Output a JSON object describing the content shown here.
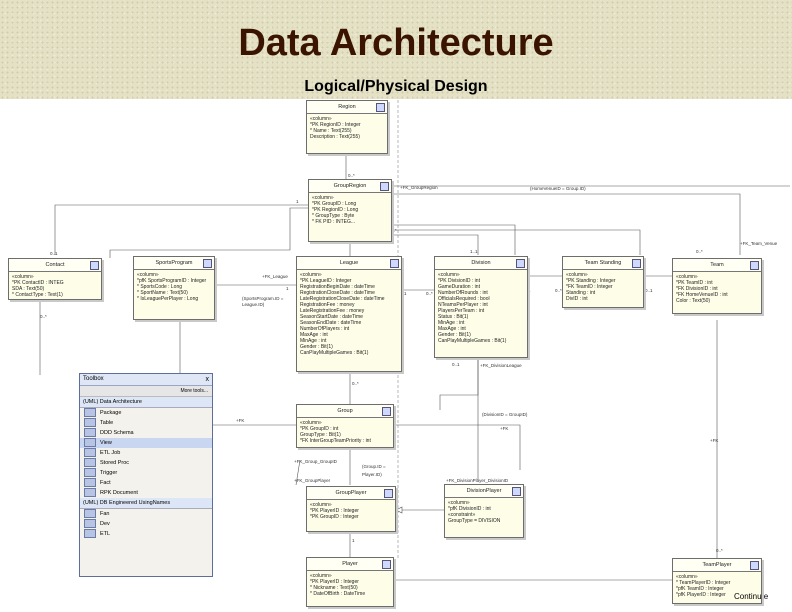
{
  "slide": {
    "title": "Data Architecture",
    "subtitle": "Logical/Physical Design",
    "continue_text": "Continu e"
  },
  "entities": {
    "region": {
      "name": "Region",
      "lines": [
        "«column»",
        "*PK RegionID : Integer",
        "*  Name : Text(255)",
        "   Description : Text(255)"
      ]
    },
    "group_region": {
      "name": "GroupRegion",
      "lines": [
        "«column»",
        "*PK GroupID : Long",
        "*PK RegionID : Long",
        "*  GroupType : Byte",
        "*  FK PID : INTEG..."
      ]
    },
    "contact": {
      "name": "Contact",
      "lines": [
        "«column»",
        "*PK ContactID : INTEG",
        "   SDA : Text(50)",
        "*  ContactType : Text(1)"
      ]
    },
    "sports_program": {
      "name": "SportsProgram",
      "lines": [
        "«column»",
        "*pfK SportsProgramID : Integer",
        "*  SportsCode : Long",
        "*  SportName : Text(50)",
        "*  IsLeaguePerPlayer : Long"
      ]
    },
    "league": {
      "name": "League",
      "lines": [
        "«column»",
        "*PK LeagueID : Integer",
        "   RegistrationBeginDate : dateTime",
        "   RegistrationCloseDate : dateTime",
        "   LateRegistrationCloseDate : dateTime",
        "   RegistrationFee : money",
        "   LateRegistrationFee : money",
        "   SeasonStartDate : dateTime",
        "   SeasonEndDate : dateTime",
        "   NumberOfPlayers : int",
        "   MaxAge : int",
        "   MinAge : int",
        "   Gender : Bit(1)",
        "   CanPlayMultipleGames : Bit(1)"
      ]
    },
    "division": {
      "name": "Division",
      "lines": [
        "«column»",
        "*PK DivisionID : int",
        "   GameDuration : int",
        "   NumberOfRounds : int",
        "   OfficialsRequired : bool",
        "   NTeamsPerPlayer : int",
        "   PlayersPerTeam : int",
        "   Status : Bit(1)",
        "   MinAge : int",
        "   MaxAge : int",
        "   Gender : Bit(1)",
        "   CanPlayMultipleGames : Bit(1)"
      ]
    },
    "team_standing": {
      "name": "Team Standing",
      "lines": [
        "«column»",
        "*PK Standing : Integer",
        "*FK TeamID : Integer",
        "   Standing : int",
        "   DivID : int"
      ]
    },
    "team": {
      "name": "Team",
      "lines": [
        "«column»",
        "*PK TeamID : int",
        "*FK DivisionID : int",
        "*FK HomeVenueID : int",
        "   Color : Text(50)"
      ]
    },
    "group": {
      "name": "Group",
      "lines": [
        "«column»",
        "*PK GroupID : int",
        "   GroupType : Bit(1)",
        "*FK InterGroupTeamPriority : int"
      ]
    },
    "group_player": {
      "name": "GroupPlayer",
      "lines": [
        "«column»",
        "*PK PlayerID : Integer",
        "*PK GroupID : Integer"
      ]
    },
    "division_player": {
      "name": "DivisionPlayer",
      "lines": [
        "«column»",
        "*pfK DivisionID : int",
        "«constraint»",
        "GroupType = DIVISION"
      ]
    },
    "player": {
      "name": "Player",
      "lines": [
        "«column»",
        "*PK PlayerID : Integer",
        "*  Nickname : Text(50)",
        "*  DateOfBirth : DateTime"
      ]
    },
    "team_player": {
      "name": "TeamPlayer",
      "lines": [
        "«column»",
        "*  TeamPlayerID : Integer",
        "*pfK TeamID : Integer",
        "*pfK PlayerID : Integer"
      ]
    }
  },
  "relationship_labels": [
    "+FK_GroupRegion",
    "+FK_Team_Venue",
    "+FK_League",
    "+FK_DivisionLeague",
    "+FK_Group_GroupID",
    "+FK_GroupPlayer",
    "+FK_DivisionPlayer_DivisionID",
    "(Group.ID = Player.ID)",
    "(SportsProgram.ID = League.ID)",
    "(DivisionID = GroupID)",
    "(HomeVenueID = Group.ID)",
    "0..*",
    "1..*",
    "1",
    "0..1",
    "1..*",
    "0..*",
    "1",
    "0..*",
    "0..1",
    "0..*",
    "1",
    "0..*",
    "1",
    "0..*",
    "0..*",
    "1",
    "0..*",
    "0..*",
    "1",
    "1"
  ],
  "toolbox": {
    "title": "Toolbox",
    "close": "x",
    "more_tools": "More tools...",
    "group1": "(UML) Data Architecture",
    "items1": [
      "Package",
      "Table",
      "DDD Schema",
      "View",
      "ETL Job",
      "Stored Proc",
      "Trigger",
      "Fact",
      "RPK Document"
    ],
    "group2": "(UML) DB Engineered UsingNames",
    "items2": [
      "Fan",
      "Dev",
      "ETL"
    ]
  }
}
